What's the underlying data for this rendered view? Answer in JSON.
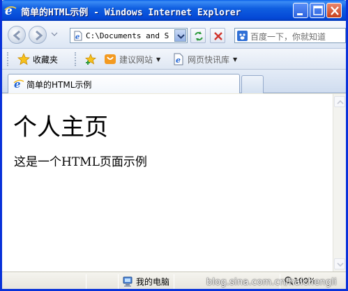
{
  "window": {
    "title": "简单的HTML示例 - Windows Internet Explorer"
  },
  "navbar": {
    "address": "C:\\Documents and S",
    "search_placeholder": "百度一下，你就知道"
  },
  "favorites_bar": {
    "favorites_label": "收藏夹",
    "items": [
      {
        "label": "建议网站",
        "icon": "suggested-sites-icon"
      },
      {
        "label": "网页快讯库",
        "icon": "web-slice-icon"
      }
    ]
  },
  "tabs": [
    {
      "label": "简单的HTML示例",
      "icon": "ie-icon"
    }
  ],
  "page": {
    "heading": "个人主页",
    "paragraph": "这是一个HTML页面示例"
  },
  "status_bar": {
    "zone": "我的电脑",
    "zoom": "100%"
  },
  "watermark": "blog.sina.com.cn/haichengli",
  "colors": {
    "titlebar": "#0447d6",
    "window_border": "#0831d9",
    "close_button": "#c8401b"
  }
}
